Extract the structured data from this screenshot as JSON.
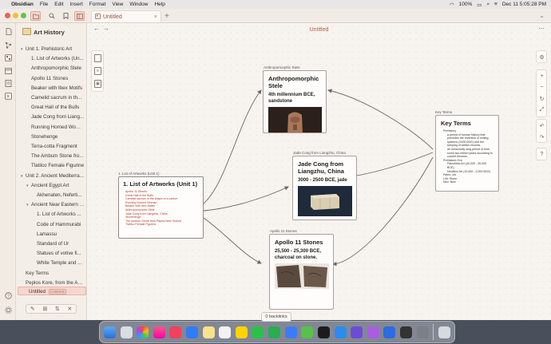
{
  "menubar": {
    "app_name": "Obsidian",
    "items": [
      "File",
      "Edit",
      "Insert",
      "Format",
      "View",
      "Window",
      "Help"
    ],
    "battery": "100%",
    "datetime": "Dec 11  5:05:28 PM"
  },
  "tab": {
    "label": "Untitled",
    "close": "×",
    "new_tab": "+"
  },
  "nav": {
    "back": "←",
    "forward": "→",
    "title": "Untitled"
  },
  "sidebar": {
    "vault_name": "Art History",
    "tree": [
      {
        "label": "Unit 1. Prehistoric Art",
        "indent": 0,
        "chevron": "▾"
      },
      {
        "label": "1. List of Artworks (Un...",
        "indent": 1,
        "chevron": ""
      },
      {
        "label": "Anthropomorphic Stele",
        "indent": 1,
        "chevron": ""
      },
      {
        "label": "Apollo 11 Stones",
        "indent": 1,
        "chevron": ""
      },
      {
        "label": "Beaker with Ibex Motifs",
        "indent": 1,
        "chevron": ""
      },
      {
        "label": "Camelid sacrum in th...",
        "indent": 1,
        "chevron": ""
      },
      {
        "label": "Great Hall of the Bulls",
        "indent": 1,
        "chevron": ""
      },
      {
        "label": "Jade Cong from Liang...",
        "indent": 1,
        "chevron": ""
      },
      {
        "label": "Running Horned Woman",
        "indent": 1,
        "chevron": ""
      },
      {
        "label": "Stonehenge",
        "indent": 1,
        "chevron": ""
      },
      {
        "label": "Terra-cotta Fragment",
        "indent": 1,
        "chevron": ""
      },
      {
        "label": "The Ambum Stone fro...",
        "indent": 1,
        "chevron": ""
      },
      {
        "label": "Tlatilco Female Figurine",
        "indent": 1,
        "chevron": ""
      },
      {
        "label": "Unit 2. Ancient Mediterra...",
        "indent": 0,
        "chevron": "▾"
      },
      {
        "label": "Ancient Egypt Art",
        "indent": 1,
        "chevron": "▾"
      },
      {
        "label": "Akhenaten, Neferti...",
        "indent": 2,
        "chevron": ""
      },
      {
        "label": "Ancient Near Eastern Art",
        "indent": 1,
        "chevron": "▾"
      },
      {
        "label": "1. List of Artworks ...",
        "indent": 2,
        "chevron": ""
      },
      {
        "label": "Code of Hammurabi",
        "indent": 2,
        "chevron": ""
      },
      {
        "label": "Lamassu",
        "indent": 2,
        "chevron": ""
      },
      {
        "label": "Standard of Ur",
        "indent": 2,
        "chevron": ""
      },
      {
        "label": "Statues of votive fi...",
        "indent": 2,
        "chevron": ""
      },
      {
        "label": "White Temple and ...",
        "indent": 2,
        "chevron": ""
      },
      {
        "label": "Key Terms",
        "indent": 0,
        "chevron": ""
      },
      {
        "label": "Peplos Kore, from the Acr...",
        "indent": 0,
        "chevron": ""
      }
    ],
    "active_item": {
      "label": "Untitled",
      "badge": "CANVAS"
    }
  },
  "canvas": {
    "list_card": {
      "label": "1. List of Artworks (Unit 1)",
      "title": "1. List of Artworks (Unit 1)",
      "links": [
        "Apollo 11 Stones",
        "Great Hall of the Bulls",
        "Camelid sacrum in the shape of a canine",
        "Running Horned Woman",
        "Beaker with Ibex Motifs",
        "Anthropomorphic Stele",
        "Jade Cong from Liangzhu, China",
        "Stonehenge",
        "The Ambum Stone from Papua New Guinea",
        "Tlatilco Female Figurine"
      ]
    },
    "anthro_card": {
      "label": "Anthropomorphic Stele",
      "title": "Anthropomorphic Stele",
      "subtitle": "4th millennium BCE, sandstone"
    },
    "jade_card": {
      "label": "Jade Cong from Liangzhu, China",
      "title": "Jade Cong from Liangzhu, China",
      "subtitle": "3000 - 2500 BCE, jade"
    },
    "apollo_card": {
      "label": "Apollo 11 Stones",
      "title": "Apollo 11 Stones",
      "subtitle": "25,500 - 25,300 BCE, charcoal on stone."
    },
    "keyterms_card": {
      "label": "Key Terms",
      "title": "Key Terms",
      "items": [
        {
          "text": "Prehistory",
          "level": 0
        },
        {
          "text": "a period of human history that precedes the invention of writing systems (3100 BCE) and the keeping of written records.",
          "level": 1
        },
        {
          "text": "an immensely long period of time, some two million years according to current theories.",
          "level": 1
        },
        {
          "text": "Prehistoric Era",
          "level": 0
        },
        {
          "text": "Paleolithic Art (40,000 - 30,000 BCE)",
          "level": 1
        },
        {
          "text": "Neolithic Art (10,000 - 3,000 BCE)",
          "level": 1
        },
        {
          "text": "Paleo: old",
          "level": 0
        },
        {
          "text": "Lith: Stone",
          "level": 0
        },
        {
          "text": "Neo: New",
          "level": 0
        }
      ]
    },
    "backlinks": "0 backlinks"
  },
  "colors": {
    "accent": "#b05a48",
    "link": "#b03a28",
    "canvas_bg": "#f7f3ef",
    "active_tree": "#f6d6cf"
  },
  "icons": {
    "ribbon": [
      "files-icon",
      "search-icon",
      "bookmark-icon",
      "graph-icon",
      "canvas-icon",
      "calendar-icon",
      "templates-icon",
      "command-icon",
      "terminal-icon"
    ],
    "right_tools": [
      "settings-icon",
      "zoom-in-icon",
      "zoom-out-icon",
      "reset-zoom-icon",
      "fit-icon",
      "undo-icon",
      "redo-icon",
      "help-icon"
    ],
    "left_tools": [
      "new-card-icon",
      "new-note-icon",
      "new-media-icon"
    ]
  }
}
